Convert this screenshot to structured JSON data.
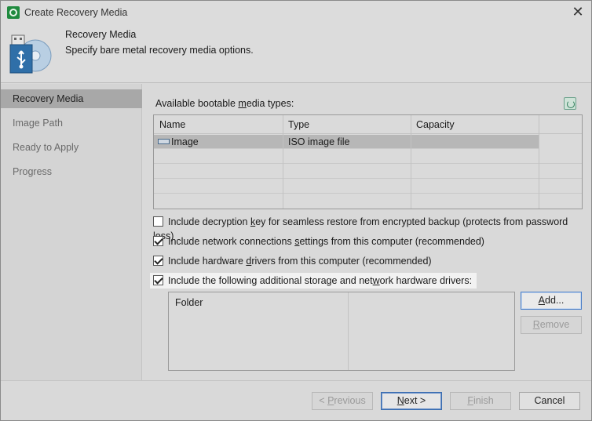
{
  "window": {
    "title": "Create Recovery Media",
    "close_glyph": "✕"
  },
  "header": {
    "title": "Recovery Media",
    "subtitle": "Specify bare metal recovery media options.",
    "icon": "usb-drive-disc-icon"
  },
  "sidebar": {
    "steps": [
      {
        "label": "Recovery Media",
        "active": true
      },
      {
        "label": "Image Path",
        "active": false
      },
      {
        "label": "Ready to Apply",
        "active": false
      },
      {
        "label": "Progress",
        "active": false
      }
    ]
  },
  "media": {
    "label_pre": "Available bootable ",
    "label_mnemonic": "m",
    "label_post": "edia types:",
    "columns": [
      "Name",
      "Type",
      "Capacity"
    ],
    "rows": [
      {
        "name": "Image",
        "type": "ISO image file",
        "capacity": ""
      }
    ]
  },
  "options": {
    "decryption": {
      "pre": "Include decryption ",
      "mn": "k",
      "post": "ey for seamless restore from encrypted backup (protects from password loss)",
      "checked": false
    },
    "network": {
      "pre": "Include network connections ",
      "mn": "s",
      "post": "ettings from this computer (recommended)",
      "checked": true
    },
    "drivers": {
      "pre": "Include hardware ",
      "mn": "d",
      "post": "rivers from this computer (recommended)",
      "checked": true
    },
    "additional": {
      "pre": "Include the following additional storage and net",
      "mn": "w",
      "post": "ork hardware drivers:",
      "checked": true
    }
  },
  "folders": {
    "column": "Folder",
    "add": {
      "mn": "A",
      "post": "dd..."
    },
    "remove": {
      "mn": "R",
      "post": "emove"
    }
  },
  "footer": {
    "previous": {
      "pre": "< ",
      "mn": "P",
      "post": "revious"
    },
    "next": {
      "mn": "N",
      "post": "ext >"
    },
    "finish": {
      "mn": "F",
      "post": "inish"
    },
    "cancel": "Cancel"
  }
}
